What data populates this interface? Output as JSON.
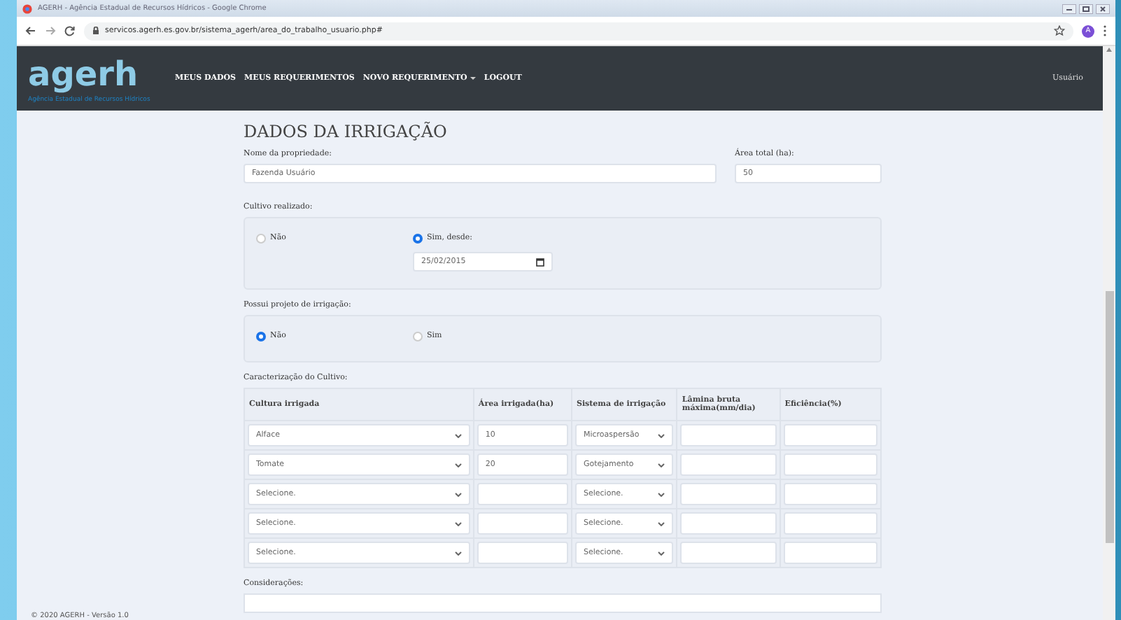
{
  "browser": {
    "window_title": "AGERH - Agência Estadual de Recursos Hídricos - Google Chrome",
    "url": "servicos.agerh.es.gov.br/sistema_agerh/area_do_trabalho_usuario.php#",
    "profile_initial": "A"
  },
  "navbar": {
    "logo": "agerh",
    "logo_tagline": "Agência Estadual de Recursos Hídricos",
    "items": [
      {
        "label": "MEUS DADOS",
        "dropdown": false
      },
      {
        "label": "MEUS REQUERIMENTOS",
        "dropdown": false
      },
      {
        "label": "NOVO REQUERIMENTO",
        "dropdown": true
      },
      {
        "label": "LOGOUT",
        "dropdown": false
      }
    ],
    "user": "Usuário"
  },
  "form": {
    "title": "DADOS DA IRRIGAÇÃO",
    "property_name": {
      "label": "Nome da propriedade:",
      "value": "Fazenda Usuário"
    },
    "total_area": {
      "label": "Área total (ha):",
      "value": "50"
    },
    "cultivation": {
      "label": "Cultivo realizado:",
      "options": [
        {
          "label": "Não",
          "selected": false
        },
        {
          "label": "Sim, desde:",
          "selected": true
        }
      ],
      "date": "25/02/2015"
    },
    "irrigation_project": {
      "label": "Possui projeto de irrigação:",
      "options": [
        {
          "label": "Não",
          "selected": true
        },
        {
          "label": "Sim",
          "selected": false
        }
      ]
    },
    "crops": {
      "label": "Caracterização do Cultivo:",
      "columns": [
        "Cultura irrigada",
        "Área irrigada(ha)",
        "Sistema de irrigação",
        "Lâmina bruta máxima(mm/dia)",
        "Eficiência(%)"
      ],
      "rows": [
        {
          "culture": "Alface",
          "area": "10",
          "system": "Microaspersão"
        },
        {
          "culture": "Tomate",
          "area": "20",
          "system": "Gotejamento"
        },
        {
          "culture": "Selecione.",
          "system": "Selecione."
        },
        {
          "culture": "Selecione.",
          "system": "Selecione."
        },
        {
          "culture": "Selecione.",
          "system": "Selecione."
        }
      ]
    },
    "considerations": {
      "label": "Considerações:"
    }
  },
  "footer": "© 2020 AGERH - Versão 1.0"
}
